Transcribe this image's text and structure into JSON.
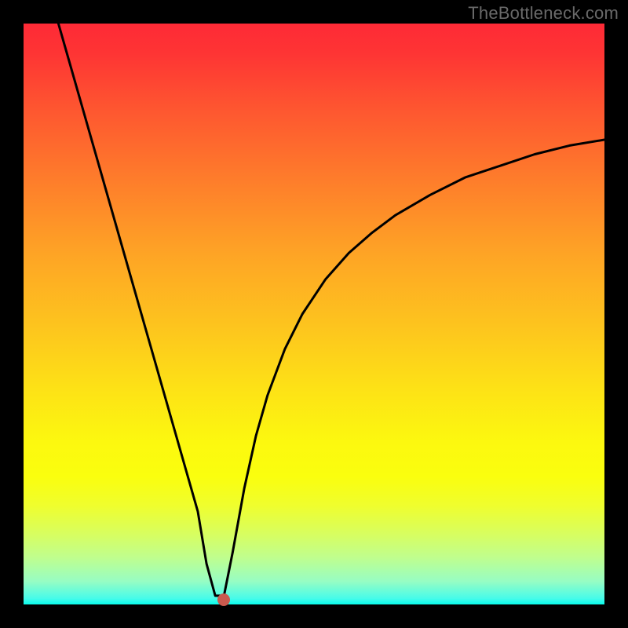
{
  "watermark": "TheBottleneck.com",
  "marker": {
    "x_frac": 0.345,
    "y_frac": 0.992
  },
  "chart_data": {
    "type": "line",
    "title": "",
    "xlabel": "",
    "ylabel": "",
    "xlim": [
      0,
      1
    ],
    "ylim": [
      0,
      1
    ],
    "series": [
      {
        "name": "curve",
        "x": [
          0.06,
          0.1,
          0.14,
          0.18,
          0.22,
          0.26,
          0.3,
          0.315,
          0.33,
          0.345,
          0.36,
          0.38,
          0.4,
          0.42,
          0.45,
          0.48,
          0.52,
          0.56,
          0.6,
          0.64,
          0.7,
          0.76,
          0.82,
          0.88,
          0.94,
          1.0
        ],
        "y": [
          0.0,
          0.14,
          0.28,
          0.42,
          0.56,
          0.7,
          0.84,
          0.93,
          0.985,
          0.985,
          0.91,
          0.8,
          0.71,
          0.64,
          0.56,
          0.5,
          0.44,
          0.395,
          0.36,
          0.33,
          0.295,
          0.265,
          0.245,
          0.225,
          0.21,
          0.2
        ]
      }
    ],
    "gradient_stops": [
      {
        "pos": 0.0,
        "color": "#fe2a36"
      },
      {
        "pos": 0.05,
        "color": "#fe3434"
      },
      {
        "pos": 0.15,
        "color": "#fe5730"
      },
      {
        "pos": 0.27,
        "color": "#fe7d2b"
      },
      {
        "pos": 0.4,
        "color": "#fea525"
      },
      {
        "pos": 0.52,
        "color": "#fdc41e"
      },
      {
        "pos": 0.63,
        "color": "#fde216"
      },
      {
        "pos": 0.72,
        "color": "#fcf80f"
      },
      {
        "pos": 0.78,
        "color": "#fafe0e"
      },
      {
        "pos": 0.83,
        "color": "#effe2e"
      },
      {
        "pos": 0.88,
        "color": "#d7fe61"
      },
      {
        "pos": 0.92,
        "color": "#bffe8f"
      },
      {
        "pos": 0.96,
        "color": "#97fdc3"
      },
      {
        "pos": 0.99,
        "color": "#46fbea"
      },
      {
        "pos": 1.0,
        "color": "#08fbeb"
      }
    ]
  }
}
